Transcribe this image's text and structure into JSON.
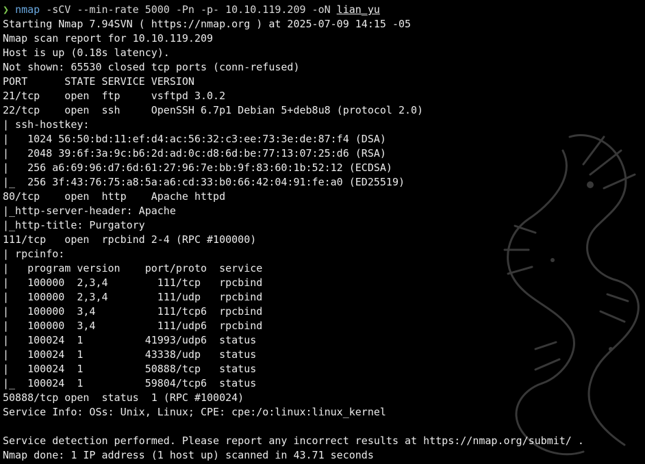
{
  "terminal": {
    "command": {
      "prompt_glyph": "❯",
      "name": "nmap",
      "args": " -sCV --min-rate 5000 -Pn -p- 10.10.119.209 -oN ",
      "output_file": "lian_yu"
    },
    "output_lines": [
      "Starting Nmap 7.94SVN ( https://nmap.org ) at 2025-07-09 14:15 -05",
      "Nmap scan report for 10.10.119.209",
      "Host is up (0.18s latency).",
      "Not shown: 65530 closed tcp ports (conn-refused)",
      "PORT      STATE SERVICE VERSION",
      "21/tcp    open  ftp     vsftpd 3.0.2",
      "22/tcp    open  ssh     OpenSSH 6.7p1 Debian 5+deb8u8 (protocol 2.0)",
      "| ssh-hostkey:",
      "|   1024 56:50:bd:11:ef:d4:ac:56:32:c3:ee:73:3e:de:87:f4 (DSA)",
      "|   2048 39:6f:3a:9c:b6:2d:ad:0c:d8:6d:be:77:13:07:25:d6 (RSA)",
      "|   256 a6:69:96:d7:6d:61:27:96:7e:bb:9f:83:60:1b:52:12 (ECDSA)",
      "|_  256 3f:43:76:75:a8:5a:a6:cd:33:b0:66:42:04:91:fe:a0 (ED25519)",
      "80/tcp    open  http    Apache httpd",
      "|_http-server-header: Apache",
      "|_http-title: Purgatory",
      "111/tcp   open  rpcbind 2-4 (RPC #100000)",
      "| rpcinfo:",
      "|   program version    port/proto  service",
      "|   100000  2,3,4        111/tcp   rpcbind",
      "|   100000  2,3,4        111/udp   rpcbind",
      "|   100000  3,4          111/tcp6  rpcbind",
      "|   100000  3,4          111/udp6  rpcbind",
      "|   100024  1          41993/udp6  status",
      "|   100024  1          43338/udp   status",
      "|   100024  1          50888/tcp   status",
      "|_  100024  1          59804/tcp6  status",
      "50888/tcp open  status  1 (RPC #100024)",
      "Service Info: OSs: Unix, Linux; CPE: cpe:/o:linux:linux_kernel",
      "",
      "Service detection performed. Please report any incorrect results at https://nmap.org/submit/ .",
      "Nmap done: 1 IP address (1 host up) scanned in 43.71 seconds"
    ]
  }
}
